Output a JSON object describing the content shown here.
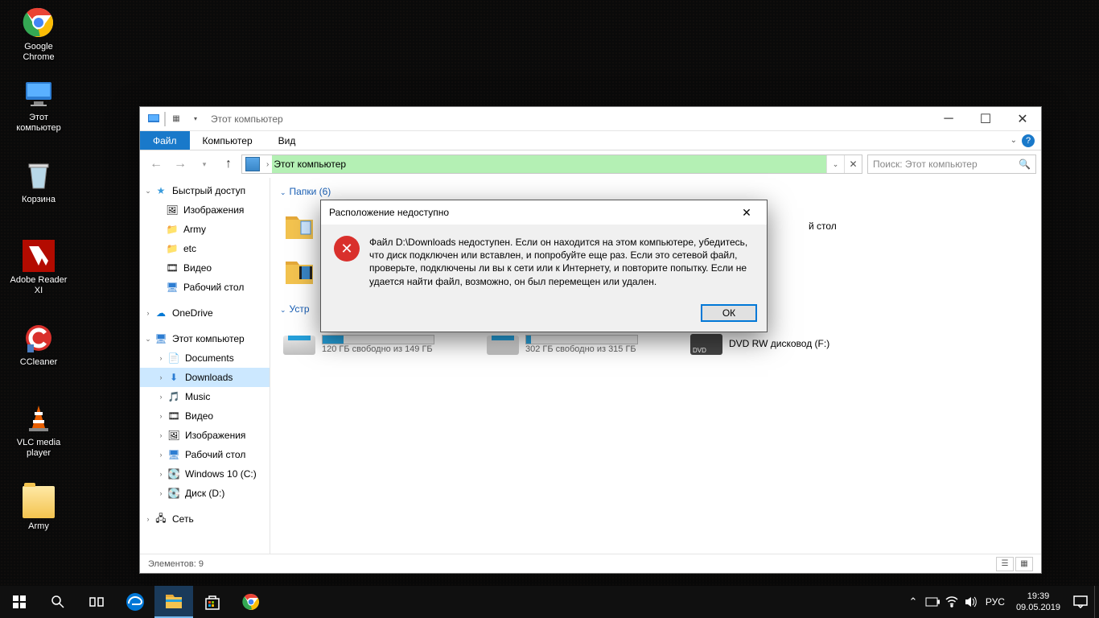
{
  "desktop_icons": [
    {
      "label": "Google Chrome",
      "id": "chrome"
    },
    {
      "label": "Этот компьютер",
      "id": "thispc"
    },
    {
      "label": "Корзина",
      "id": "recyclebin"
    },
    {
      "label": "Adobe Reader XI",
      "id": "adobe"
    },
    {
      "label": "CCleaner",
      "id": "ccleaner"
    },
    {
      "label": "VLC media player",
      "id": "vlc"
    },
    {
      "label": "Army",
      "id": "army"
    }
  ],
  "explorer": {
    "title": "Этот компьютер",
    "tabs": {
      "file": "Файл",
      "computer": "Компьютер",
      "view": "Вид"
    },
    "address": "Этот компьютер",
    "search_placeholder": "Поиск: Этот компьютер",
    "sidebar": {
      "quick_access": "Быстрый доступ",
      "qa_items": [
        "Изображения",
        "Army",
        "etc",
        "Видео",
        "Рабочий стол"
      ],
      "onedrive": "OneDrive",
      "this_pc": "Этот компьютер",
      "pc_items": [
        "Documents",
        "Downloads",
        "Music",
        "Видео",
        "Изображения",
        "Рабочий стол",
        "Windows 10 (C:)",
        "Диск (D:)"
      ],
      "network": "Сеть"
    },
    "sections": {
      "folders_header": "Папки (6)",
      "devices_header": "Устр",
      "folders_partial": [
        "",
        "",
        "й стол"
      ],
      "drives": [
        {
          "free": "120 ГБ свободно из 149 ГБ",
          "pct": 19
        },
        {
          "free": "302 ГБ свободно из 315 ГБ",
          "pct": 4
        },
        {
          "label": "DVD RW дисковод (F:)"
        }
      ]
    },
    "status": "Элементов: 9"
  },
  "dialog": {
    "title": "Расположение недоступно",
    "message": "Файл D:\\Downloads недоступен. Если он находится на этом компьютере, убедитесь, что диск подключен или вставлен, и попробуйте еще раз. Если это сетевой файл, проверьте, подключены ли вы к сети или к Интернету, и повторите попытку. Если не удается найти файл, возможно, он был перемещен или удален.",
    "ok": "ОК"
  },
  "taskbar": {
    "lang": "РУС",
    "time": "19:39",
    "date": "09.05.2019"
  }
}
